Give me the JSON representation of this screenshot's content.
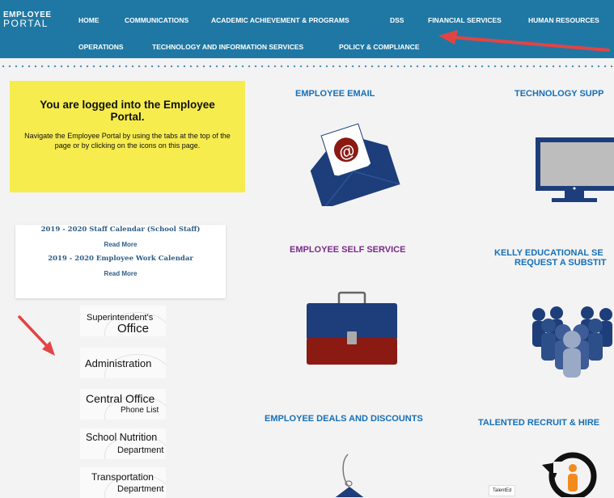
{
  "nav": {
    "logo_line1": "EMPLOYEE",
    "logo_line2": "PORTAL",
    "items": [
      "HOME",
      "COMMUNICATIONS",
      "ACADEMIC ACHIEVEMENT & PROGRAMS",
      "DSS",
      "FINANCIAL SERVICES",
      "HUMAN RESOURCES",
      "OPERATIONS",
      "TECHNOLOGY AND INFORMATION SERVICES",
      "POLICY & COMPLIANCE"
    ]
  },
  "welcome": {
    "title": "You are logged into the Employee Portal.",
    "subtitle": "Navigate the Employee Portal by using the tabs at the top of the page or by clicking on the icons on this page."
  },
  "calendars": [
    {
      "title": "2019 - 2020 Staff Calendar (School Staff)",
      "link": "Read More"
    },
    {
      "title": "2019 - 2020 Employee Work Calendar",
      "link": "Read More"
    }
  ],
  "departments": [
    {
      "line1": "Superintendent's",
      "line2": "Office"
    },
    {
      "line1": "Administration",
      "line2": ""
    },
    {
      "line1": "Central Office",
      "line2": "Phone List"
    },
    {
      "line1": "School Nutrition",
      "line2": "Department"
    },
    {
      "line1": "Transportation",
      "line2": "Department"
    }
  ],
  "sections": {
    "email": "EMPLOYEE EMAIL",
    "tech": "TECHNOLOGY SUPP",
    "self_service": "EMPLOYEE SELF SERVICE",
    "kelly_line1": "KELLY EDUCATIONAL SE",
    "kelly_line2": "REQUEST A SUBSTIT",
    "deals": "EMPLOYEE DEALS AND DISCOUNTS",
    "talented": "TALENTED RECRUIT & HIRE"
  },
  "email_icon_symbol": "@",
  "talented_label": "TalentEd",
  "colors": {
    "nav_bg": "#1f78a4",
    "yellow": "#f6ec4e",
    "navy": "#1d3e7a",
    "dark_red": "#8b1a12",
    "title_blue": "#1670b8",
    "title_purple": "#7a2a8c",
    "arrow_red": "#e24444"
  }
}
